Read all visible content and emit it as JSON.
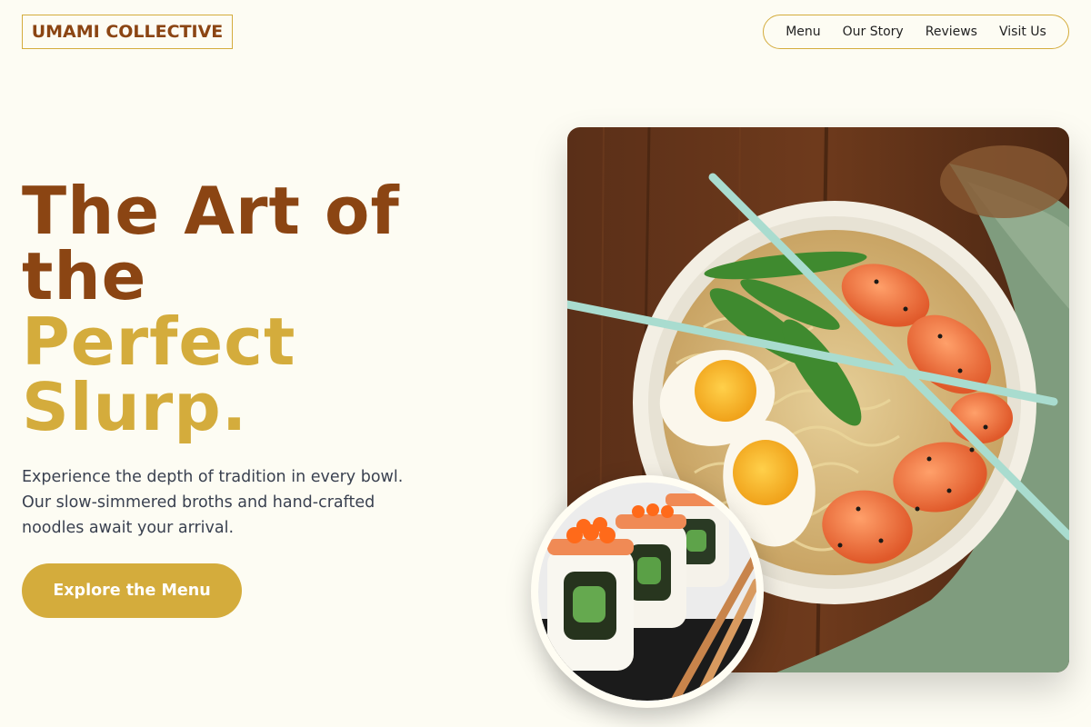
{
  "brand": {
    "logo_text": "UMAMI COLLECTIVE"
  },
  "nav": {
    "items": [
      "Menu",
      "Our Story",
      "Reviews",
      "Visit Us"
    ]
  },
  "hero": {
    "headline_line1": "The Art of",
    "headline_line2": "the",
    "headline_line3": "Perfect",
    "headline_line4": "Slurp.",
    "subtext": "Experience the depth of tradition in every bowl. Our slow-simmered broths and hand-crafted noodles await your arrival.",
    "cta_label": "Explore the Menu"
  },
  "images": {
    "main": "ramen-bowl-photo",
    "inset": "sushi-roll-photo"
  },
  "colors": {
    "background": "#fdfcf3",
    "brand_brown": "#8b4513",
    "accent_gold": "#d4ac3c",
    "body_text": "#3a4150"
  }
}
